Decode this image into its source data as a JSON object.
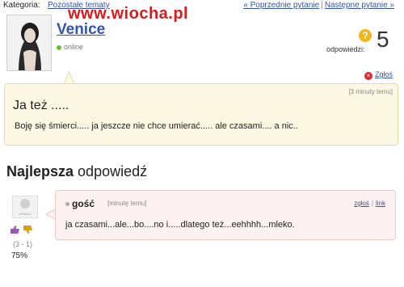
{
  "topbar": {
    "category_label": "Kategoria:",
    "category_link": "Pozostałe tematy",
    "prev_link": "« Poprzednie pytanie",
    "separator": "|",
    "next_link": "Następne pytanie »"
  },
  "watermark": {
    "text": "www.wiocha.pl"
  },
  "user": {
    "name": "Venice",
    "status": "online"
  },
  "answers": {
    "icon_glyph": "?",
    "label": "odpowiedzi:",
    "count": "5"
  },
  "report": {
    "label": "Zgłoś",
    "icon_glyph": "×"
  },
  "question": {
    "time": "[3 minuty temu]",
    "title": "Ja też .....",
    "body": "Boję się śmierci..... ja jeszcze nie chce umierać..... ale czasami.... a nic.."
  },
  "best_answer": {
    "title_bold": "Najlepsza",
    "title_rest": " odpowiedź",
    "avatar_caption": "UPADEL",
    "votes": "(3 - 1)",
    "percent": "75%",
    "author": "gość",
    "time": "[minutę temu]",
    "report_link": "zgłoś",
    "link_label": "link",
    "text": "ja czasami...ale...bo....no i.....dlatego też...eehhhh...mleko."
  },
  "colors": {
    "link": "#3355aa",
    "watermark": "#d81c1c",
    "question_bg": "#fdf8e3",
    "answer_bg": "#fdf1f1",
    "thumb_up": "#9b59b6",
    "thumb_down": "#d4a017"
  },
  "icons": [
    "question-mark-icon",
    "report-x-icon",
    "thumbs-up-icon",
    "thumbs-down-icon",
    "online-dot-icon"
  ]
}
